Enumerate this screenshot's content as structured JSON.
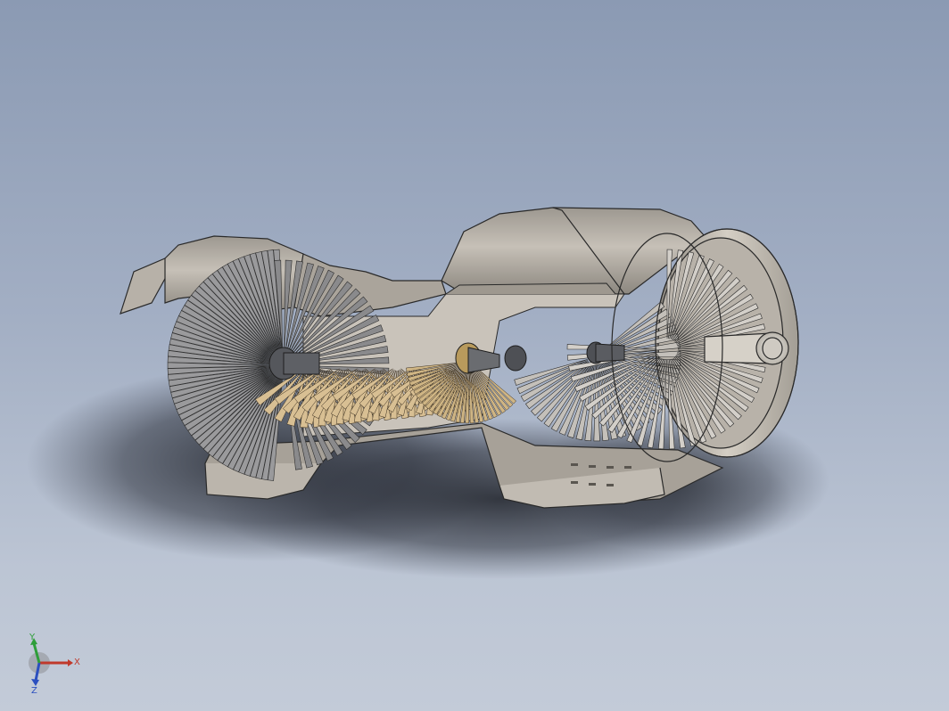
{
  "viewport": {
    "background_top": "#8b9ab3",
    "background_bottom": "#c3cbd8"
  },
  "model": {
    "casing_color": "#b4aea6",
    "casing_dark": "#8d8780",
    "blade_gray": "#9a9a9c",
    "compressor_blade_color": "#d8bf93",
    "outline_color": "#2a2a2a"
  },
  "triad": {
    "x_label": "X",
    "y_label": "Y",
    "z_label": "Z",
    "x_color": "#c0392b",
    "y_color": "#2e9e3a",
    "z_color": "#2b4fbf"
  }
}
